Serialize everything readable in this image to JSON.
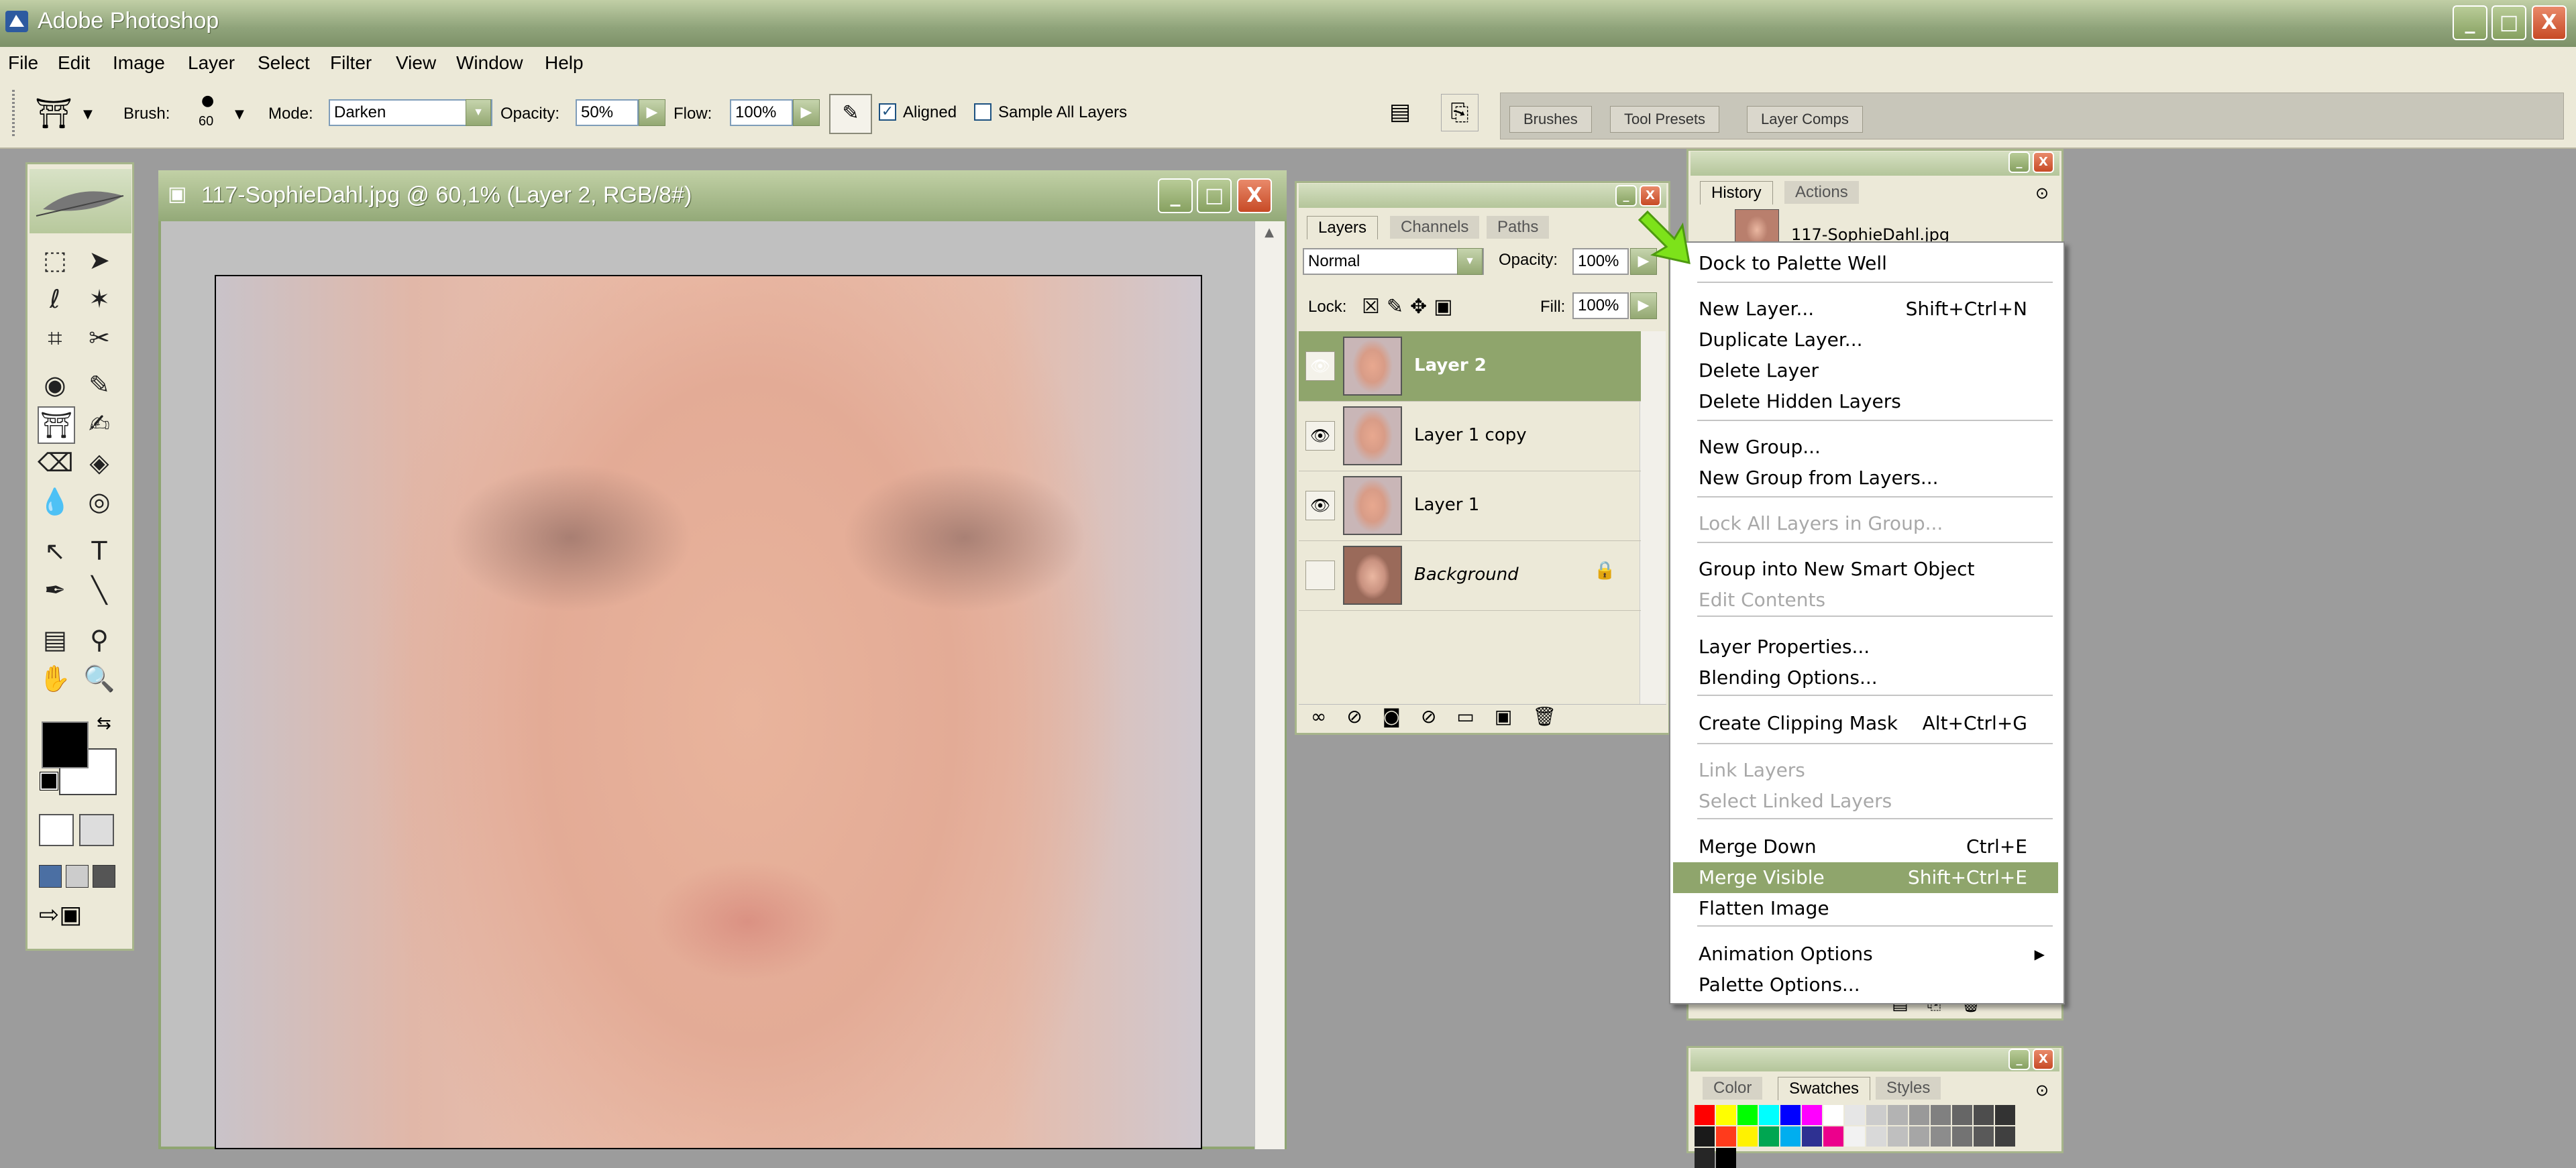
{
  "app": {
    "title": "Adobe Photoshop"
  },
  "window_controls": {
    "minimize": "_",
    "restore": "□",
    "close": "X"
  },
  "menubar": [
    "File",
    "Edit",
    "Image",
    "Layer",
    "Select",
    "Filter",
    "View",
    "Window",
    "Help"
  ],
  "options": {
    "brush_label": "Brush:",
    "brush_size": "60",
    "mode_label": "Mode:",
    "mode_value": "Darken",
    "opacity_label": "Opacity:",
    "opacity_value": "50%",
    "flow_label": "Flow:",
    "flow_value": "100%",
    "aligned_label": "Aligned",
    "aligned_checked": true,
    "sample_label": "Sample All Layers",
    "sample_checked": false
  },
  "palette_well": {
    "tabs": [
      "Brushes",
      "Tool Presets",
      "Layer Comps"
    ]
  },
  "document": {
    "title": "117-SophieDahl.jpg @ 60,1% (Layer 2, RGB/8#)"
  },
  "layers_palette": {
    "tabs": [
      "Layers",
      "Channels",
      "Paths"
    ],
    "blend_mode": "Normal",
    "opacity_label": "Opacity:",
    "opacity_value": "100%",
    "lock_label": "Lock:",
    "fill_label": "Fill:",
    "fill_value": "100%",
    "layers": [
      {
        "name": "Layer 2",
        "visible": true,
        "selected": true
      },
      {
        "name": "Layer 1 copy",
        "visible": true,
        "selected": false
      },
      {
        "name": "Layer 1",
        "visible": true,
        "selected": false
      },
      {
        "name": "Background",
        "visible": false,
        "selected": false,
        "locked": true
      }
    ]
  },
  "history_palette": {
    "tabs": [
      "History",
      "Actions"
    ],
    "snapshot": "117-SophieDahl.jpg"
  },
  "color_palette": {
    "tabs": [
      "Color",
      "Swatches",
      "Styles"
    ]
  },
  "context_menu": {
    "items": [
      {
        "label": "Dock to Palette Well",
        "shortcut": "",
        "disabled": false
      },
      {
        "label": "New Layer...",
        "shortcut": "Shift+Ctrl+N",
        "disabled": false
      },
      {
        "label": "Duplicate Layer...",
        "shortcut": "",
        "disabled": false
      },
      {
        "label": "Delete Layer",
        "shortcut": "",
        "disabled": false
      },
      {
        "label": "Delete Hidden Layers",
        "shortcut": "",
        "disabled": false
      },
      {
        "label": "New Group...",
        "shortcut": "",
        "disabled": false
      },
      {
        "label": "New Group from Layers...",
        "shortcut": "",
        "disabled": false
      },
      {
        "label": "Lock All Layers in Group...",
        "shortcut": "",
        "disabled": true
      },
      {
        "label": "Group into New Smart Object",
        "shortcut": "",
        "disabled": false
      },
      {
        "label": "Edit Contents",
        "shortcut": "",
        "disabled": true
      },
      {
        "label": "Layer Properties...",
        "shortcut": "",
        "disabled": false
      },
      {
        "label": "Blending Options...",
        "shortcut": "",
        "disabled": false
      },
      {
        "label": "Create Clipping Mask",
        "shortcut": "Alt+Ctrl+G",
        "disabled": false
      },
      {
        "label": "Link Layers",
        "shortcut": "",
        "disabled": true
      },
      {
        "label": "Select Linked Layers",
        "shortcut": "",
        "disabled": true
      },
      {
        "label": "Merge Down",
        "shortcut": "Ctrl+E",
        "disabled": false
      },
      {
        "label": "Merge Visible",
        "shortcut": "Shift+Ctrl+E",
        "disabled": false,
        "highlighted": true
      },
      {
        "label": "Flatten Image",
        "shortcut": "",
        "disabled": false
      },
      {
        "label": "Animation Options",
        "shortcut": "",
        "disabled": false,
        "submenu": true
      },
      {
        "label": "Palette Options...",
        "shortcut": "",
        "disabled": false
      }
    ]
  },
  "colors": {
    "accent": "#8fa56c",
    "titlebar": "#93a978",
    "panel": "#ece9d8",
    "arrow": "#7de21a"
  }
}
